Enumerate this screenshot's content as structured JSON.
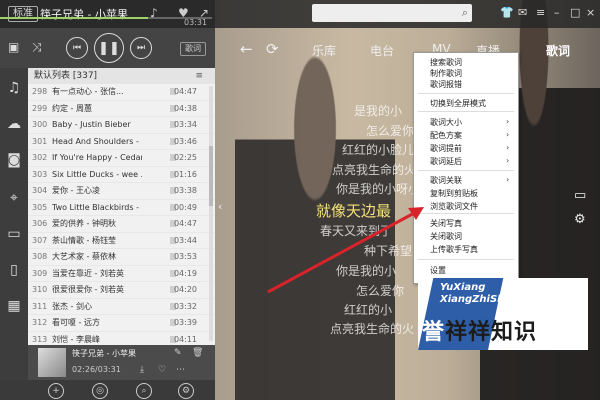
{
  "topbar": {
    "mode_label": "标准",
    "song_title": "筷子兄弟 - 小苹果",
    "time_current": "",
    "time_total": "03:31",
    "progress_fraction": 0.7
  },
  "controls": {
    "lyrics_mode_label": "歌词"
  },
  "playlist": {
    "header": "默认列表 [337]",
    "rows": [
      {
        "num": "298",
        "title": "有一点动心 - 张信...",
        "dur": "04:47"
      },
      {
        "num": "299",
        "title": "约定 - 周蕙",
        "dur": "04:38"
      },
      {
        "num": "300",
        "title": "Baby - Justin Bieber",
        "dur": "03:34"
      },
      {
        "num": "301",
        "title": "Head And Shoulders - Ki...",
        "dur": "03:46"
      },
      {
        "num": "302",
        "title": "If You're Happy - Cedar...",
        "dur": "02:25"
      },
      {
        "num": "303",
        "title": "Six Little Ducks - wee ...",
        "dur": "01:16"
      },
      {
        "num": "304",
        "title": "爱你 - 王心凌",
        "dur": "03:38"
      },
      {
        "num": "305",
        "title": "Two Little Blackbirds - ...",
        "dur": "00:49"
      },
      {
        "num": "306",
        "title": "爱的供养 - 钟明秋",
        "dur": "04:47"
      },
      {
        "num": "307",
        "title": "茶山情歌 - 杨钰莹",
        "dur": "03:44"
      },
      {
        "num": "308",
        "title": "大艺术家 - 蔡依林",
        "dur": "03:53"
      },
      {
        "num": "309",
        "title": "当爱在靠近 - 刘若英",
        "dur": "04:19"
      },
      {
        "num": "310",
        "title": "很爱很爱你 - 刘若英",
        "dur": "04:20"
      },
      {
        "num": "311",
        "title": "张杰 - 剑心",
        "dur": "03:32"
      },
      {
        "num": "312",
        "title": "看可嗄 - 远方",
        "dur": "03:39"
      },
      {
        "num": "313",
        "title": "刘恺 - 李晨峰",
        "dur": "04:11"
      }
    ]
  },
  "mini_player": {
    "title": "筷子兄弟 - 小苹果",
    "time": "02:26/03:31"
  },
  "nav": {
    "tabs": [
      "乐库",
      "电台",
      "MV",
      "直播",
      "歌词"
    ],
    "active": "歌词"
  },
  "lyrics": [
    "是我的小",
    "怎么爱你都",
    "红红的小脸儿温",
    "点亮我生命的火",
    "你是我的小呀小",
    "就像天边最",
    "春天又来到了",
    "种下希望就",
    "你是我的小",
    "怎么爱你",
    "红红的小",
    "点亮我生命的火"
  ],
  "context_menu": {
    "items": [
      {
        "label": "搜索歌词",
        "arrow": false
      },
      {
        "label": "制作歌词",
        "arrow": false
      },
      {
        "label": "歌词报错",
        "arrow": false
      },
      {
        "label": "切换到全屏模式",
        "arrow": false
      },
      {
        "label": "歌词大小",
        "arrow": true
      },
      {
        "label": "配色方案",
        "arrow": true
      },
      {
        "label": "歌词提前",
        "arrow": true
      },
      {
        "label": "歌词延后",
        "arrow": true
      },
      {
        "label": "歌词关联",
        "arrow": true
      },
      {
        "label": "复制到剪贴板",
        "arrow": false
      },
      {
        "label": "浏览歌词文件",
        "arrow": false
      },
      {
        "label": "关闭写真",
        "arrow": false
      },
      {
        "label": "关闭歌词",
        "arrow": false
      },
      {
        "label": "上传歌手写真",
        "arrow": false
      },
      {
        "label": "设置",
        "arrow": false
      }
    ]
  },
  "watermark": {
    "en_line1": "YuXiang",
    "en_line2": "XiangZhiShi",
    "cn_text_a": "誉",
    "cn_text_b": "祥祥知识"
  },
  "colors": {
    "accent_green": "#9ed36a",
    "lyric_highlight": "#f5e17a",
    "annotation_red": "#d9232a",
    "watermark_blue": "#2f5ea8"
  }
}
